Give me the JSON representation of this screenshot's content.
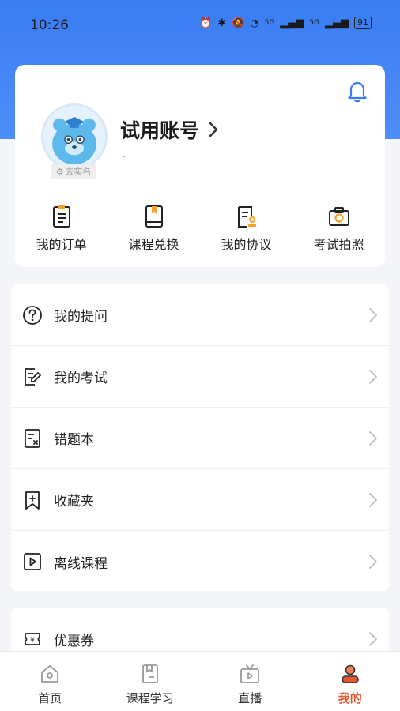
{
  "status": {
    "time": "10:26",
    "signal1": "5G",
    "signal2": "5G",
    "battery": "91"
  },
  "profile": {
    "name": "试用账号",
    "subline": "-",
    "verify_tag": "去实名"
  },
  "shortcuts": [
    {
      "label": "我的订单",
      "icon": "order-icon"
    },
    {
      "label": "课程兑换",
      "icon": "course-redeem-icon"
    },
    {
      "label": "我的协议",
      "icon": "agreement-icon"
    },
    {
      "label": "考试拍照",
      "icon": "camera-icon"
    }
  ],
  "menu": [
    {
      "label": "我的提问",
      "icon": "question-icon"
    },
    {
      "label": "我的考试",
      "icon": "exam-icon"
    },
    {
      "label": "错题本",
      "icon": "wrong-book-icon"
    },
    {
      "label": "收藏夹",
      "icon": "bookmark-icon"
    },
    {
      "label": "离线课程",
      "icon": "offline-video-icon"
    }
  ],
  "menu2": [
    {
      "label": "优惠券",
      "icon": "coupon-icon"
    }
  ],
  "tabs": [
    {
      "label": "首页",
      "icon": "home-icon"
    },
    {
      "label": "课程学习",
      "icon": "study-icon"
    },
    {
      "label": "直播",
      "icon": "live-tv-icon"
    },
    {
      "label": "我的",
      "icon": "profile-icon",
      "active": true
    }
  ],
  "colors": {
    "header_blue": "#3a7df3",
    "active_tab": "#e2572f",
    "icon_orange": "#f4a22b"
  }
}
